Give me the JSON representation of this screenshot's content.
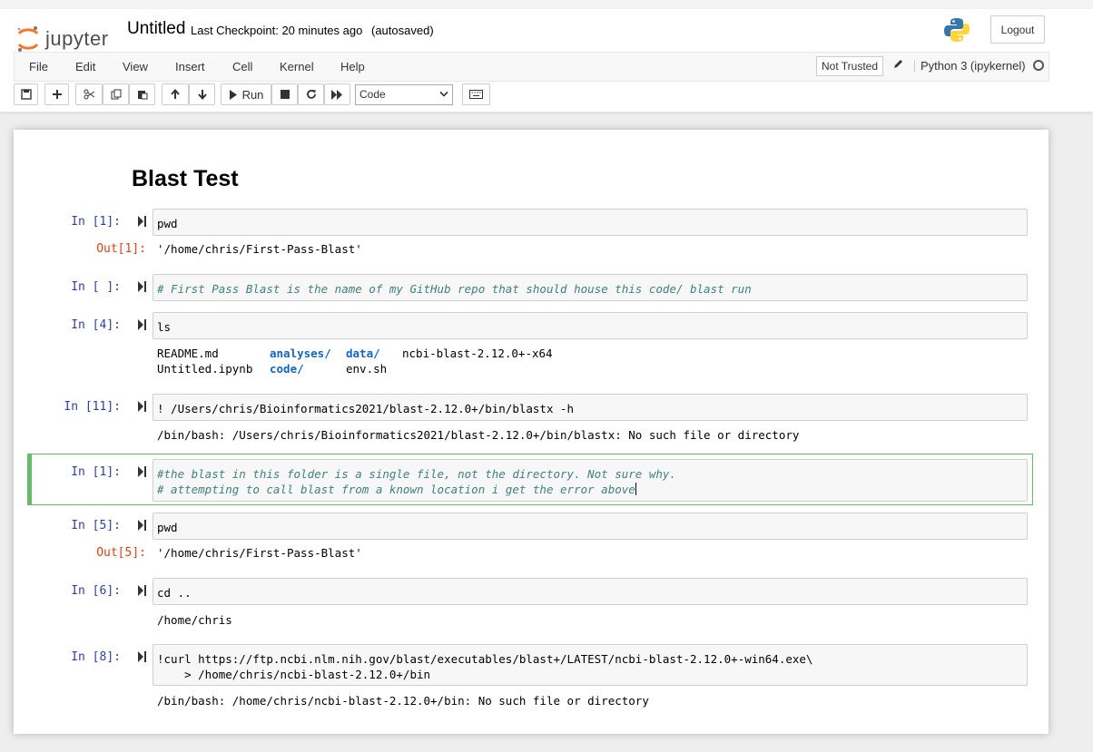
{
  "header": {
    "logo_text": "jupyter",
    "notebook_title": "Untitled",
    "checkpoint": "Last Checkpoint: 20 minutes ago",
    "autosave": "(autosaved)",
    "logout": "Logout"
  },
  "menu": {
    "items": [
      "File",
      "Edit",
      "View",
      "Insert",
      "Cell",
      "Kernel",
      "Help"
    ],
    "trust": "Not Trusted",
    "kernel": "Python 3 (ipykernel)"
  },
  "toolbar": {
    "run_label": "Run",
    "cell_type": "Code"
  },
  "notebook": {
    "heading": "Blast Test",
    "cells": [
      {
        "prompt": "In [1]:",
        "source": "pwd",
        "out_prompt": "Out[1]:",
        "output": "'/home/chris/First-Pass-Blast'"
      },
      {
        "prompt": "In [ ]:",
        "source": "# First Pass Blast is the name of my GitHub repo that should house this code/ blast run"
      },
      {
        "prompt": "In [4]:",
        "source": "ls",
        "output_rows": [
          [
            "README.md",
            "analyses/",
            "data/",
            "ncbi-blast-2.12.0+-x64"
          ],
          [
            "Untitled.ipynb",
            "code/",
            "env.sh",
            ""
          ]
        ]
      },
      {
        "prompt": "In [11]:",
        "source": "! /Users/chris/Bioinformatics2021/blast-2.12.0+/bin/blastx -h",
        "output": "/bin/bash: /Users/chris/Bioinformatics2021/blast-2.12.0+/bin/blastx: No such file or directory"
      },
      {
        "prompt": "In [1]:",
        "source_line1": "#the blast in this folder is a single file, not the directory. Not sure why.",
        "source_line2": "# attempting to call blast from a known location i get the error above"
      },
      {
        "prompt": "In [5]:",
        "source": "pwd",
        "out_prompt": "Out[5]:",
        "output": "'/home/chris/First-Pass-Blast'"
      },
      {
        "prompt": "In [6]:",
        "source": "cd ..",
        "output": "/home/chris"
      },
      {
        "prompt": "In [8]:",
        "source_line1": "!curl https://ftp.ncbi.nlm.nih.gov/blast/executables/blast+/LATEST/ncbi-blast-2.12.0+-win64.exe\\",
        "source_line2": "    > /home/chris/ncbi-blast-2.12.0+/bin",
        "output": "/bin/bash: /home/chris/ncbi-blast-2.12.0+/bin: No such file or directory"
      }
    ]
  }
}
